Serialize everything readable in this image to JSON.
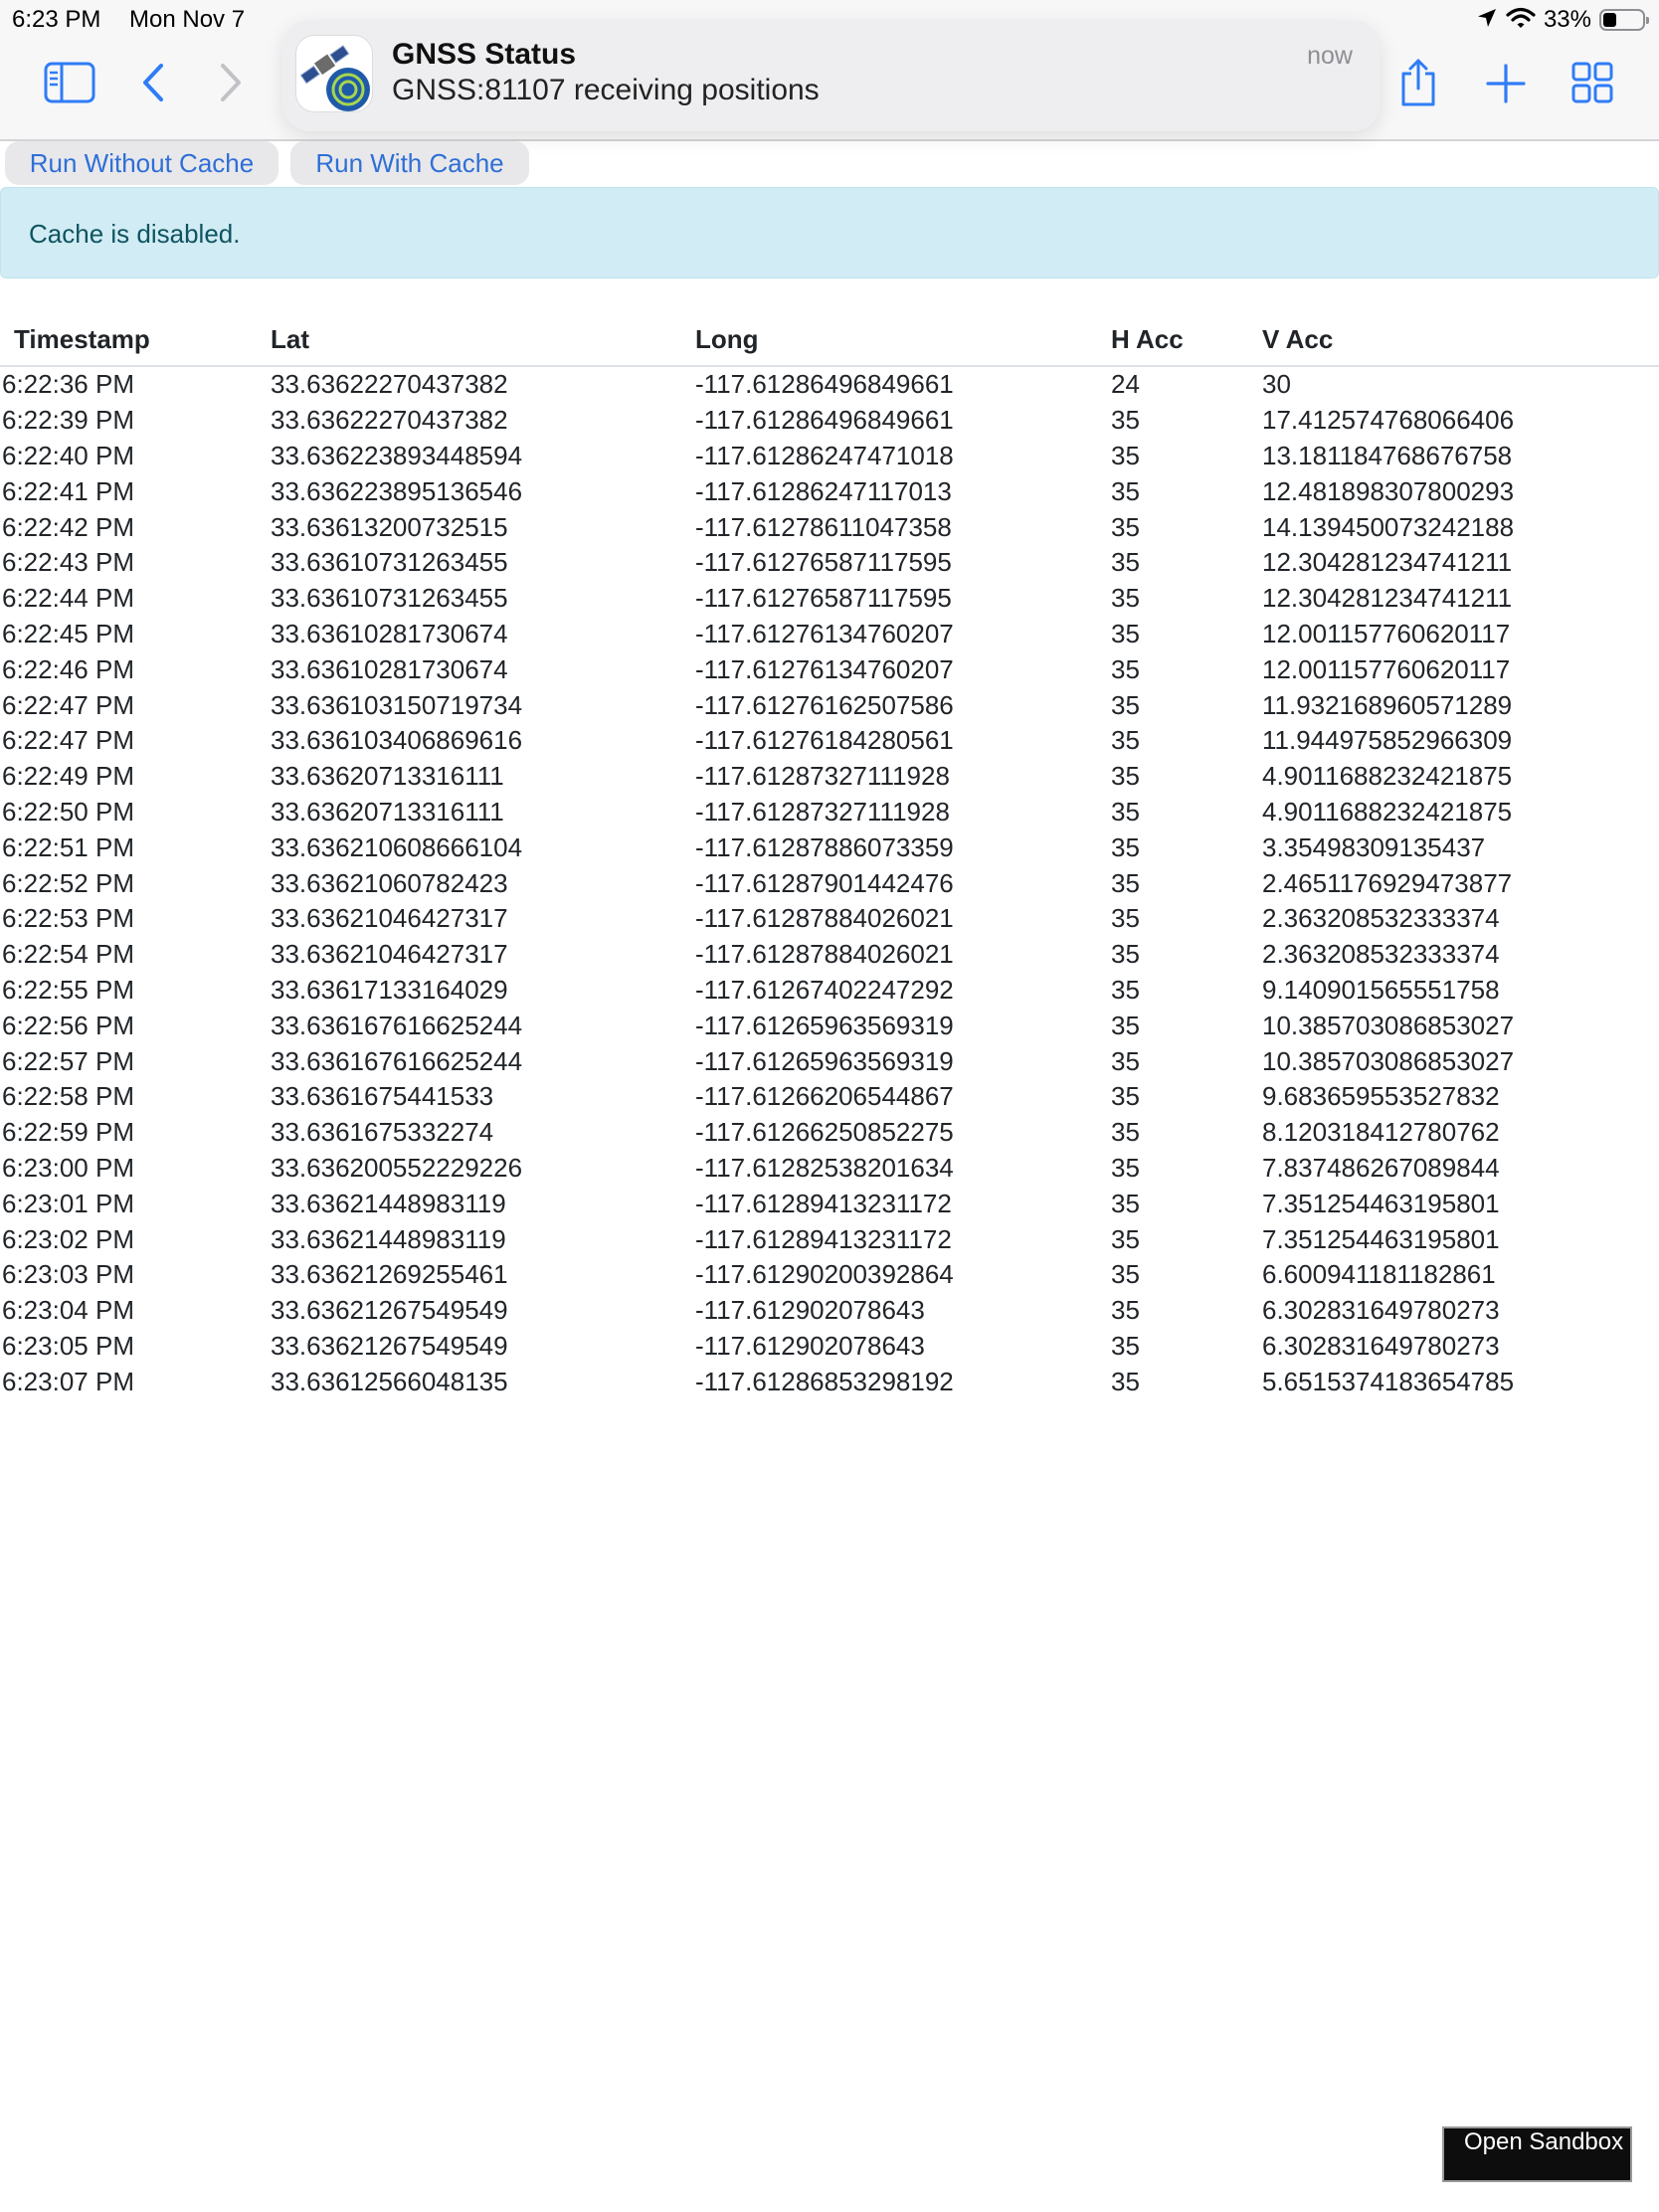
{
  "status_bar": {
    "time": "6:23 PM",
    "date": "Mon Nov 7",
    "battery": "33%",
    "battery_level": 0.33
  },
  "toolbar": {
    "icons": [
      "sidebar-icon",
      "back-chevron-icon",
      "forward-chevron-icon",
      "share-icon",
      "plus-icon",
      "tabs-grid-icon"
    ]
  },
  "notification": {
    "title": "GNSS Status",
    "body": "GNSS:81107 receiving positions",
    "time": "now",
    "app_icon": "satellite-app-icon"
  },
  "buttons": {
    "without_cache": "Run Without Cache",
    "with_cache": "Run With Cache"
  },
  "alert": {
    "text": "Cache is disabled."
  },
  "table": {
    "headers": [
      "Timestamp",
      "Lat",
      "Long",
      "H Acc",
      "V Acc"
    ],
    "rows": [
      [
        "6:22:36 PM",
        "33.63622270437382",
        "-117.61286496849661",
        "24",
        "30"
      ],
      [
        "6:22:39 PM",
        "33.63622270437382",
        "-117.61286496849661",
        "35",
        "17.412574768066406"
      ],
      [
        "6:22:40 PM",
        "33.636223893448594",
        "-117.61286247471018",
        "35",
        "13.181184768676758"
      ],
      [
        "6:22:41 PM",
        "33.636223895136546",
        "-117.61286247117013",
        "35",
        "12.481898307800293"
      ],
      [
        "6:22:42 PM",
        "33.63613200732515",
        "-117.61278611047358",
        "35",
        "14.139450073242188"
      ],
      [
        "6:22:43 PM",
        "33.63610731263455",
        "-117.61276587117595",
        "35",
        "12.304281234741211"
      ],
      [
        "6:22:44 PM",
        "33.63610731263455",
        "-117.61276587117595",
        "35",
        "12.304281234741211"
      ],
      [
        "6:22:45 PM",
        "33.63610281730674",
        "-117.61276134760207",
        "35",
        "12.001157760620117"
      ],
      [
        "6:22:46 PM",
        "33.63610281730674",
        "-117.61276134760207",
        "35",
        "12.001157760620117"
      ],
      [
        "6:22:47 PM",
        "33.636103150719734",
        "-117.61276162507586",
        "35",
        "11.932168960571289"
      ],
      [
        "6:22:47 PM",
        "33.636103406869616",
        "-117.61276184280561",
        "35",
        "11.944975852966309"
      ],
      [
        "6:22:49 PM",
        "33.63620713316111",
        "-117.61287327111928",
        "35",
        "4.9011688232421875"
      ],
      [
        "6:22:50 PM",
        "33.63620713316111",
        "-117.61287327111928",
        "35",
        "4.9011688232421875"
      ],
      [
        "6:22:51 PM",
        "33.636210608666104",
        "-117.61287886073359",
        "35",
        "3.35498309135437"
      ],
      [
        "6:22:52 PM",
        "33.63621060782423",
        "-117.61287901442476",
        "35",
        "2.4651176929473877"
      ],
      [
        "6:22:53 PM",
        "33.63621046427317",
        "-117.61287884026021",
        "35",
        "2.363208532333374"
      ],
      [
        "6:22:54 PM",
        "33.63621046427317",
        "-117.61287884026021",
        "35",
        "2.363208532333374"
      ],
      [
        "6:22:55 PM",
        "33.63617133164029",
        "-117.61267402247292",
        "35",
        "9.140901565551758"
      ],
      [
        "6:22:56 PM",
        "33.636167616625244",
        "-117.61265963569319",
        "35",
        "10.385703086853027"
      ],
      [
        "6:22:57 PM",
        "33.636167616625244",
        "-117.61265963569319",
        "35",
        "10.385703086853027"
      ],
      [
        "6:22:58 PM",
        "33.6361675441533",
        "-117.61266206544867",
        "35",
        "9.683659553527832"
      ],
      [
        "6:22:59 PM",
        "33.6361675332274",
        "-117.61266250852275",
        "35",
        "8.120318412780762"
      ],
      [
        "6:23:00 PM",
        "33.636200552229226",
        "-117.61282538201634",
        "35",
        "7.837486267089844"
      ],
      [
        "6:23:01 PM",
        "33.63621448983119",
        "-117.61289413231172",
        "35",
        "7.351254463195801"
      ],
      [
        "6:23:02 PM",
        "33.63621448983119",
        "-117.61289413231172",
        "35",
        "7.351254463195801"
      ],
      [
        "6:23:03 PM",
        "33.63621269255461",
        "-117.61290200392864",
        "35",
        "6.600941181182861"
      ],
      [
        "6:23:04 PM",
        "33.63621267549549",
        "-117.612902078643",
        "35",
        "6.302831649780273"
      ],
      [
        "6:23:05 PM",
        "33.63621267549549",
        "-117.612902078643",
        "35",
        "6.302831649780273"
      ],
      [
        "6:23:07 PM",
        "33.63612566048135",
        "-117.61286853298192",
        "35",
        "5.6515374183654785"
      ]
    ]
  },
  "sandbox_button": {
    "label": "Open Sandbox"
  },
  "colors": {
    "accent": "#2f6fd6",
    "alert_bg": "#d1ecf4",
    "alert_text": "#0f5460",
    "toolbar_bg": "#f7f7f8"
  }
}
